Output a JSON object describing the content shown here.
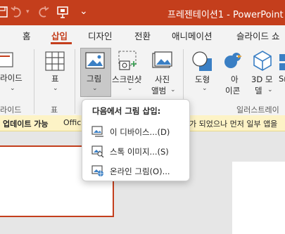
{
  "titlebar": {
    "title": "프레젠테이션1 - PowerPoint",
    "customize_glyph": "⌄"
  },
  "tabs": [
    {
      "label": "홈"
    },
    {
      "label": "삽입",
      "active": true
    },
    {
      "label": "디자인"
    },
    {
      "label": "전환"
    },
    {
      "label": "애니메이션"
    },
    {
      "label": "슬라이드 쇼"
    }
  ],
  "ribbon": {
    "slide_label": "라이드",
    "table_label": "표",
    "image_label": "그림",
    "screenshot_label": "스크린샷",
    "album_label_1": "사진",
    "album_label_2": "앨범",
    "shapes_label": "도형",
    "icons_label_1": "아",
    "icons_label_2": "이콘",
    "model3d_label_1": "3D 모",
    "model3d_label_2": "델",
    "smartart_label": "Sr",
    "groups": {
      "slides": "라이드",
      "tables": "표",
      "illustrations": "일러스트레이"
    }
  },
  "messagebar": {
    "bold": "업데이트 가능",
    "text": "Offic",
    "text_right": "가 되었으나 먼저 일부 앱을"
  },
  "menu": {
    "title": "다음에서 그림 삽입:",
    "items": [
      {
        "label": "이 디바이스...(D)",
        "icon": "device-picture-icon"
      },
      {
        "label": "스톡 이미지...(S)",
        "icon": "stock-image-icon"
      },
      {
        "label": "온라인 그림(O)...",
        "icon": "online-picture-icon"
      }
    ]
  },
  "colors": {
    "accent": "#c43e1c",
    "ribbon_bg": "#f3f3f3",
    "message_bg": "#fdf3c6"
  }
}
